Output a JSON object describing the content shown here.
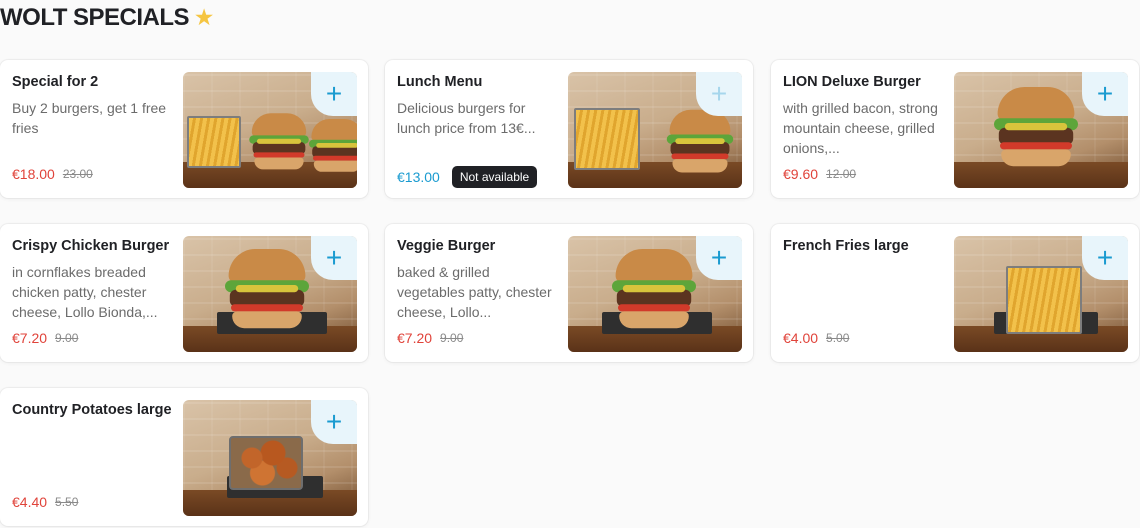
{
  "section": {
    "title": "WOLT SPECIALS",
    "icon": "star-emoji-icon"
  },
  "items": [
    {
      "name": "Special for 2",
      "description": "Buy 2 burgers, get 1 free fries",
      "price": "€18.00",
      "old_price": "23.00",
      "price_color": "#e0433a",
      "add_label": "+"
    },
    {
      "name": "Lunch Menu",
      "description": "Delicious burgers for lunch price from 13€...",
      "price": "€13.00",
      "badge": "Not available",
      "price_color": "#1a9bd0",
      "add_label": "+"
    },
    {
      "name": "LION Deluxe Burger",
      "description": "with grilled bacon, strong mountain cheese, grilled onions,...",
      "price": "€9.60",
      "old_price": "12.00",
      "price_color": "#e0433a",
      "add_label": "+"
    },
    {
      "name": "Crispy Chicken Burger",
      "description": "in cornflakes breaded chicken patty, chester cheese, Lollo Bionda,...",
      "price": "€7.20",
      "old_price": "9.00",
      "price_color": "#e0433a",
      "add_label": "+"
    },
    {
      "name": "Veggie Burger",
      "description": "baked & grilled vegetables patty, chester cheese, Lollo...",
      "price": "€7.20",
      "old_price": "9.00",
      "price_color": "#e0433a",
      "add_label": "+"
    },
    {
      "name": "French Fries large",
      "description": "",
      "price": "€4.00",
      "old_price": "5.00",
      "price_color": "#e0433a",
      "add_label": "+"
    },
    {
      "name": "Country Potatoes large",
      "description": "",
      "price": "€4.40",
      "old_price": "5.50",
      "price_color": "#e0433a",
      "add_label": "+"
    }
  ]
}
